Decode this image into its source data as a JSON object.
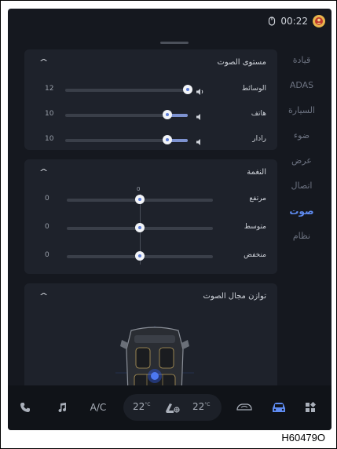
{
  "status": {
    "time": "00:22"
  },
  "sidebar": {
    "items": [
      {
        "label": "قيادة",
        "active": false
      },
      {
        "label": "ADAS",
        "active": false
      },
      {
        "label": "السيارة",
        "active": false
      },
      {
        "label": "ضوء",
        "active": false
      },
      {
        "label": "عرض",
        "active": false
      },
      {
        "label": "اتصال",
        "active": false
      },
      {
        "label": "صوت",
        "active": true
      },
      {
        "label": "نظام",
        "active": false
      }
    ]
  },
  "volume": {
    "title": "مستوى الصوت",
    "rows": [
      {
        "label": "الوسائط",
        "value": "12",
        "max": 30
      },
      {
        "label": "هاتف",
        "value": "10",
        "max": 30
      },
      {
        "label": "رادار",
        "value": "10",
        "max": 30
      }
    ]
  },
  "tone": {
    "title": "النغمة",
    "zero_label": "0",
    "rows": [
      {
        "label": "مرتفع",
        "value": "0"
      },
      {
        "label": "متوسط",
        "value": "0"
      },
      {
        "label": "منخفض",
        "value": "0"
      }
    ]
  },
  "balance": {
    "title": "توازن مجال الصوت"
  },
  "bottombar": {
    "ac_label": "A/C",
    "temp_left": "22",
    "temp_right": "22",
    "temp_unit": "°C"
  },
  "caption": "H60479O",
  "colors": {
    "accent": "#5f8cf2",
    "slider_fill": "#7d92d0",
    "screen_bg": "#15181f",
    "card_bg": "#1e222b"
  }
}
